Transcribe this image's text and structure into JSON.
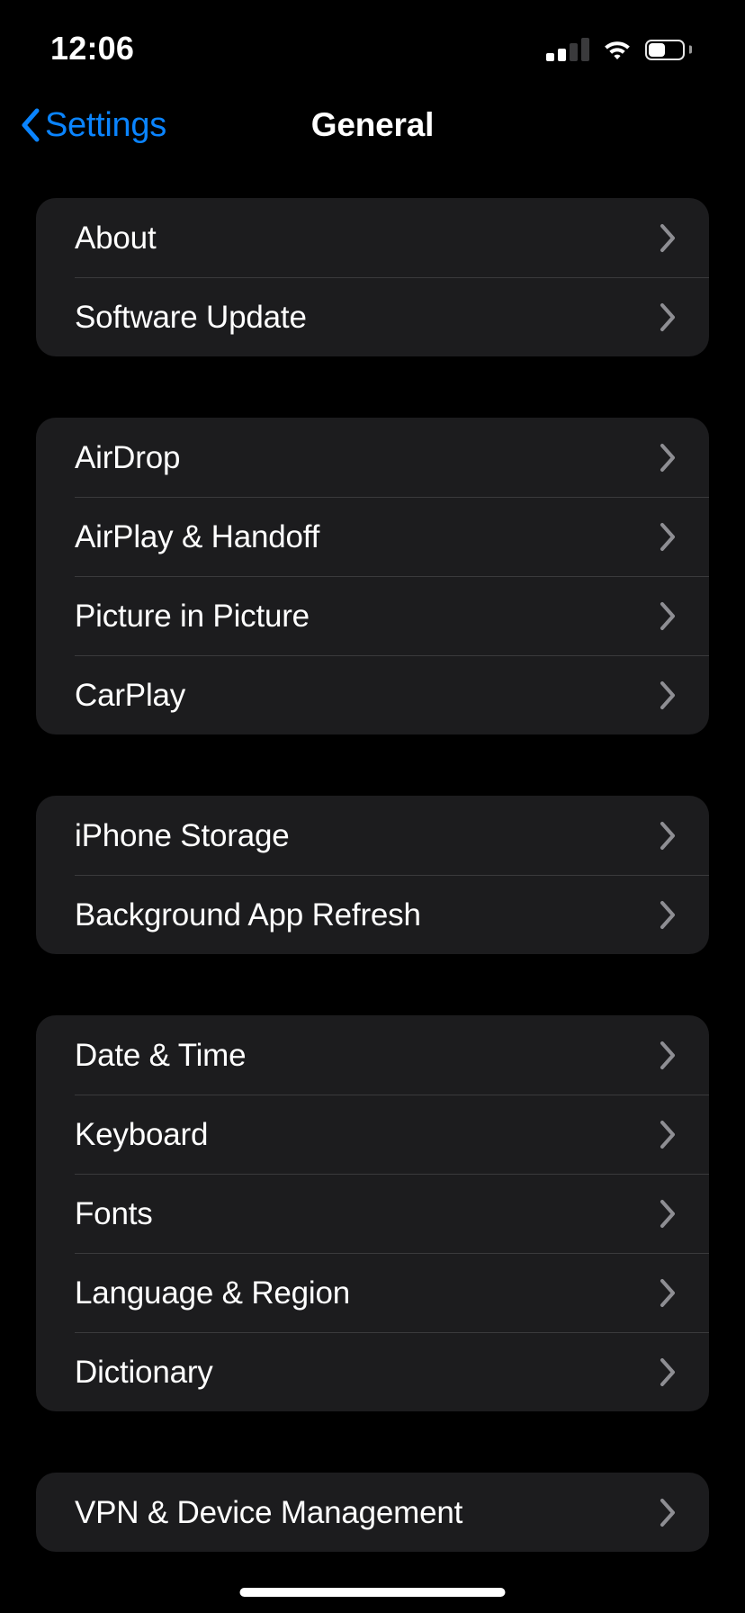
{
  "status_bar": {
    "time": "12:06",
    "signal_icon": "cellular-signal-icon",
    "signal_bars_total": 4,
    "signal_bars_filled": 2,
    "wifi_icon": "wifi-icon",
    "battery_icon": "battery-icon",
    "battery_level_percent": 50
  },
  "nav": {
    "back_icon": "chevron-left-icon",
    "back_label": "Settings",
    "title": "General"
  },
  "colors": {
    "background": "#000000",
    "card": "#1C1C1E",
    "separator": "#3A3A3C",
    "accent_blue": "#0A84FF",
    "label": "#FFFFFF",
    "chevron": "#8E8E93"
  },
  "groups": [
    {
      "rows": [
        {
          "label": "About",
          "accessory": "chevron-right-icon"
        },
        {
          "label": "Software Update",
          "accessory": "chevron-right-icon"
        }
      ]
    },
    {
      "rows": [
        {
          "label": "AirDrop",
          "accessory": "chevron-right-icon"
        },
        {
          "label": "AirPlay & Handoff",
          "accessory": "chevron-right-icon"
        },
        {
          "label": "Picture in Picture",
          "accessory": "chevron-right-icon"
        },
        {
          "label": "CarPlay",
          "accessory": "chevron-right-icon"
        }
      ]
    },
    {
      "rows": [
        {
          "label": "iPhone Storage",
          "accessory": "chevron-right-icon"
        },
        {
          "label": "Background App Refresh",
          "accessory": "chevron-right-icon"
        }
      ]
    },
    {
      "rows": [
        {
          "label": "Date & Time",
          "accessory": "chevron-right-icon"
        },
        {
          "label": "Keyboard",
          "accessory": "chevron-right-icon"
        },
        {
          "label": "Fonts",
          "accessory": "chevron-right-icon"
        },
        {
          "label": "Language & Region",
          "accessory": "chevron-right-icon"
        },
        {
          "label": "Dictionary",
          "accessory": "chevron-right-icon"
        }
      ]
    },
    {
      "rows": [
        {
          "label": "VPN & Device Management",
          "accessory": "chevron-right-icon"
        }
      ]
    }
  ],
  "home_indicator": "home-indicator"
}
